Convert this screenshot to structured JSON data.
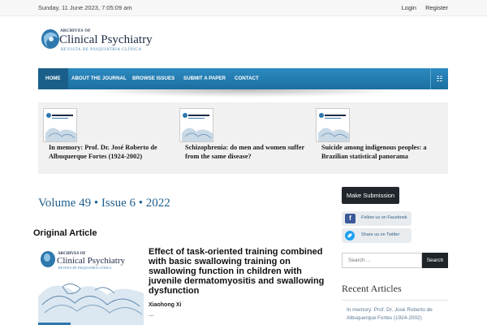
{
  "topbar": {
    "date": "Sunday, 11 June 2023, 7:05:09 am",
    "login": "Login",
    "register": "Register"
  },
  "logo": {
    "line1": "ARCHIVES OF",
    "line2": "Clinical Psychiatry",
    "line3": "REVISTA DE PSIQUIATRIA CLÍNICA"
  },
  "nav": {
    "items": [
      {
        "label": "HOME",
        "active": true
      },
      {
        "label": "ABOUT THE JOURNAL",
        "active": false
      },
      {
        "label": "BROWSE ISSUES",
        "active": false
      },
      {
        "label": "SUBMIT A PAPER",
        "active": false
      },
      {
        "label": "CONTACT",
        "active": false
      }
    ],
    "toggle_icon": "menu-toggle-icon"
  },
  "slider": {
    "items": [
      {
        "title": "In memory: Prof. Dr. José Roberto de Albuquerque Fortes (1924-2002)"
      },
      {
        "title": "Schizophrenia: do men and women suffer from the same disease?"
      },
      {
        "title": "Suicide among indigenous peoples: a Brazilian statistical panorama"
      }
    ]
  },
  "issue": {
    "heading": "Volume 49 • Issue 6 • 2022"
  },
  "section": {
    "heading": "Original Article"
  },
  "article": {
    "title": "Effect of task-oriented training combined with basic swallowing training on swallowing function in children with juvenile dermatomyositis and swallowing dysfunction",
    "author": "Xiaohong Xi",
    "more": "..."
  },
  "sidebar": {
    "submit_label": "Make Submission",
    "facebook_label": "Follow us on Facebook",
    "twitter_label": "Share us on Twitter",
    "search_placeholder": "Search ...",
    "search_button": "Search",
    "recent_heading": "Recent Articles",
    "recent_items": [
      "In memory: Prof. Dr. José Roberto de Albuquerque Fortes (1924-2002)"
    ]
  },
  "colors": {
    "nav": "#1c6fa0",
    "accent": "#1f5e8d",
    "facebook": "#3b5998",
    "twitter": "#1da1f2"
  }
}
